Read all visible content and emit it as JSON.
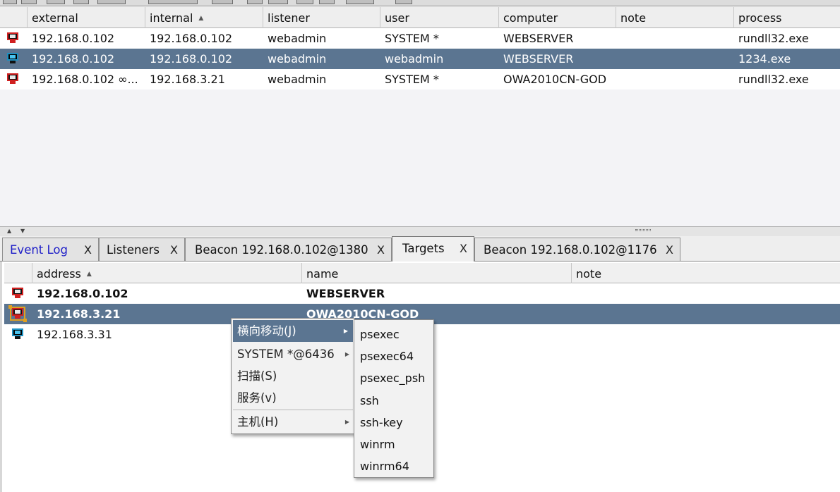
{
  "sessions": {
    "columns": [
      "external",
      "internal",
      "listener",
      "user",
      "computer",
      "note",
      "process"
    ],
    "sort_column": "internal",
    "rows": [
      {
        "icon": "red-monitor-icon",
        "external": "192.168.0.102",
        "internal": "192.168.0.102",
        "listener": "webadmin",
        "user": "SYSTEM *",
        "computer": "WEBSERVER",
        "note": "",
        "process": "rundll32.exe",
        "selected": false
      },
      {
        "icon": "blue-monitor-icon",
        "external": "192.168.0.102",
        "internal": "192.168.0.102",
        "listener": "webadmin",
        "user": "webadmin",
        "computer": "WEBSERVER",
        "note": "",
        "process": "1234.exe",
        "selected": true
      },
      {
        "icon": "red-monitor-icon",
        "external": "192.168.0.102 ∞...",
        "internal": "192.168.3.21",
        "listener": "webadmin",
        "user": "SYSTEM *",
        "computer": "OWA2010CN-GOD",
        "note": "",
        "process": "rundll32.exe",
        "selected": false
      }
    ]
  },
  "tabs": [
    {
      "label": "Event Log",
      "close": "X",
      "active": false
    },
    {
      "label": "Listeners",
      "close": "X",
      "active": false
    },
    {
      "label": "Beacon 192.168.0.102@1380",
      "close": "X",
      "active": false
    },
    {
      "label": "Targets",
      "close": "X",
      "active": true
    },
    {
      "label": "Beacon 192.168.0.102@1176",
      "close": "X",
      "active": false
    }
  ],
  "targets": {
    "columns": [
      "address",
      "name",
      "note"
    ],
    "sort_column": "address",
    "rows": [
      {
        "icon": "red-monitor-icon",
        "address": "192.168.0.102",
        "name": "WEBSERVER",
        "note": "",
        "bold": true,
        "selected": false
      },
      {
        "icon": "red-monitor-icon",
        "address": "192.168.3.21",
        "name": "OWA2010CN-GOD",
        "note": "",
        "bold": true,
        "selected": true
      },
      {
        "icon": "blue-monitor-icon",
        "address": "192.168.3.31",
        "name": "",
        "note": "",
        "bold": false,
        "selected": false
      }
    ]
  },
  "context_menu": {
    "items": [
      {
        "label": "横向移动(J)",
        "submenu": true,
        "active": true
      },
      {
        "label": "SYSTEM *@6436",
        "submenu": true,
        "active": false
      },
      {
        "label": "扫描(S)",
        "submenu": false,
        "active": false
      },
      {
        "label": "服务(v)",
        "submenu": false,
        "active": false
      },
      {
        "label": "主机(H)",
        "submenu": true,
        "active": false
      }
    ]
  },
  "lateral_submenu": {
    "items": [
      "psexec",
      "psexec64",
      "psexec_psh",
      "ssh",
      "ssh-key",
      "winrm",
      "winrm64"
    ]
  },
  "colors": {
    "selection": "#5b7591",
    "event_log_label": "#2020c8",
    "icon_red": "#d02020",
    "icon_blue": "#49c3ee"
  }
}
